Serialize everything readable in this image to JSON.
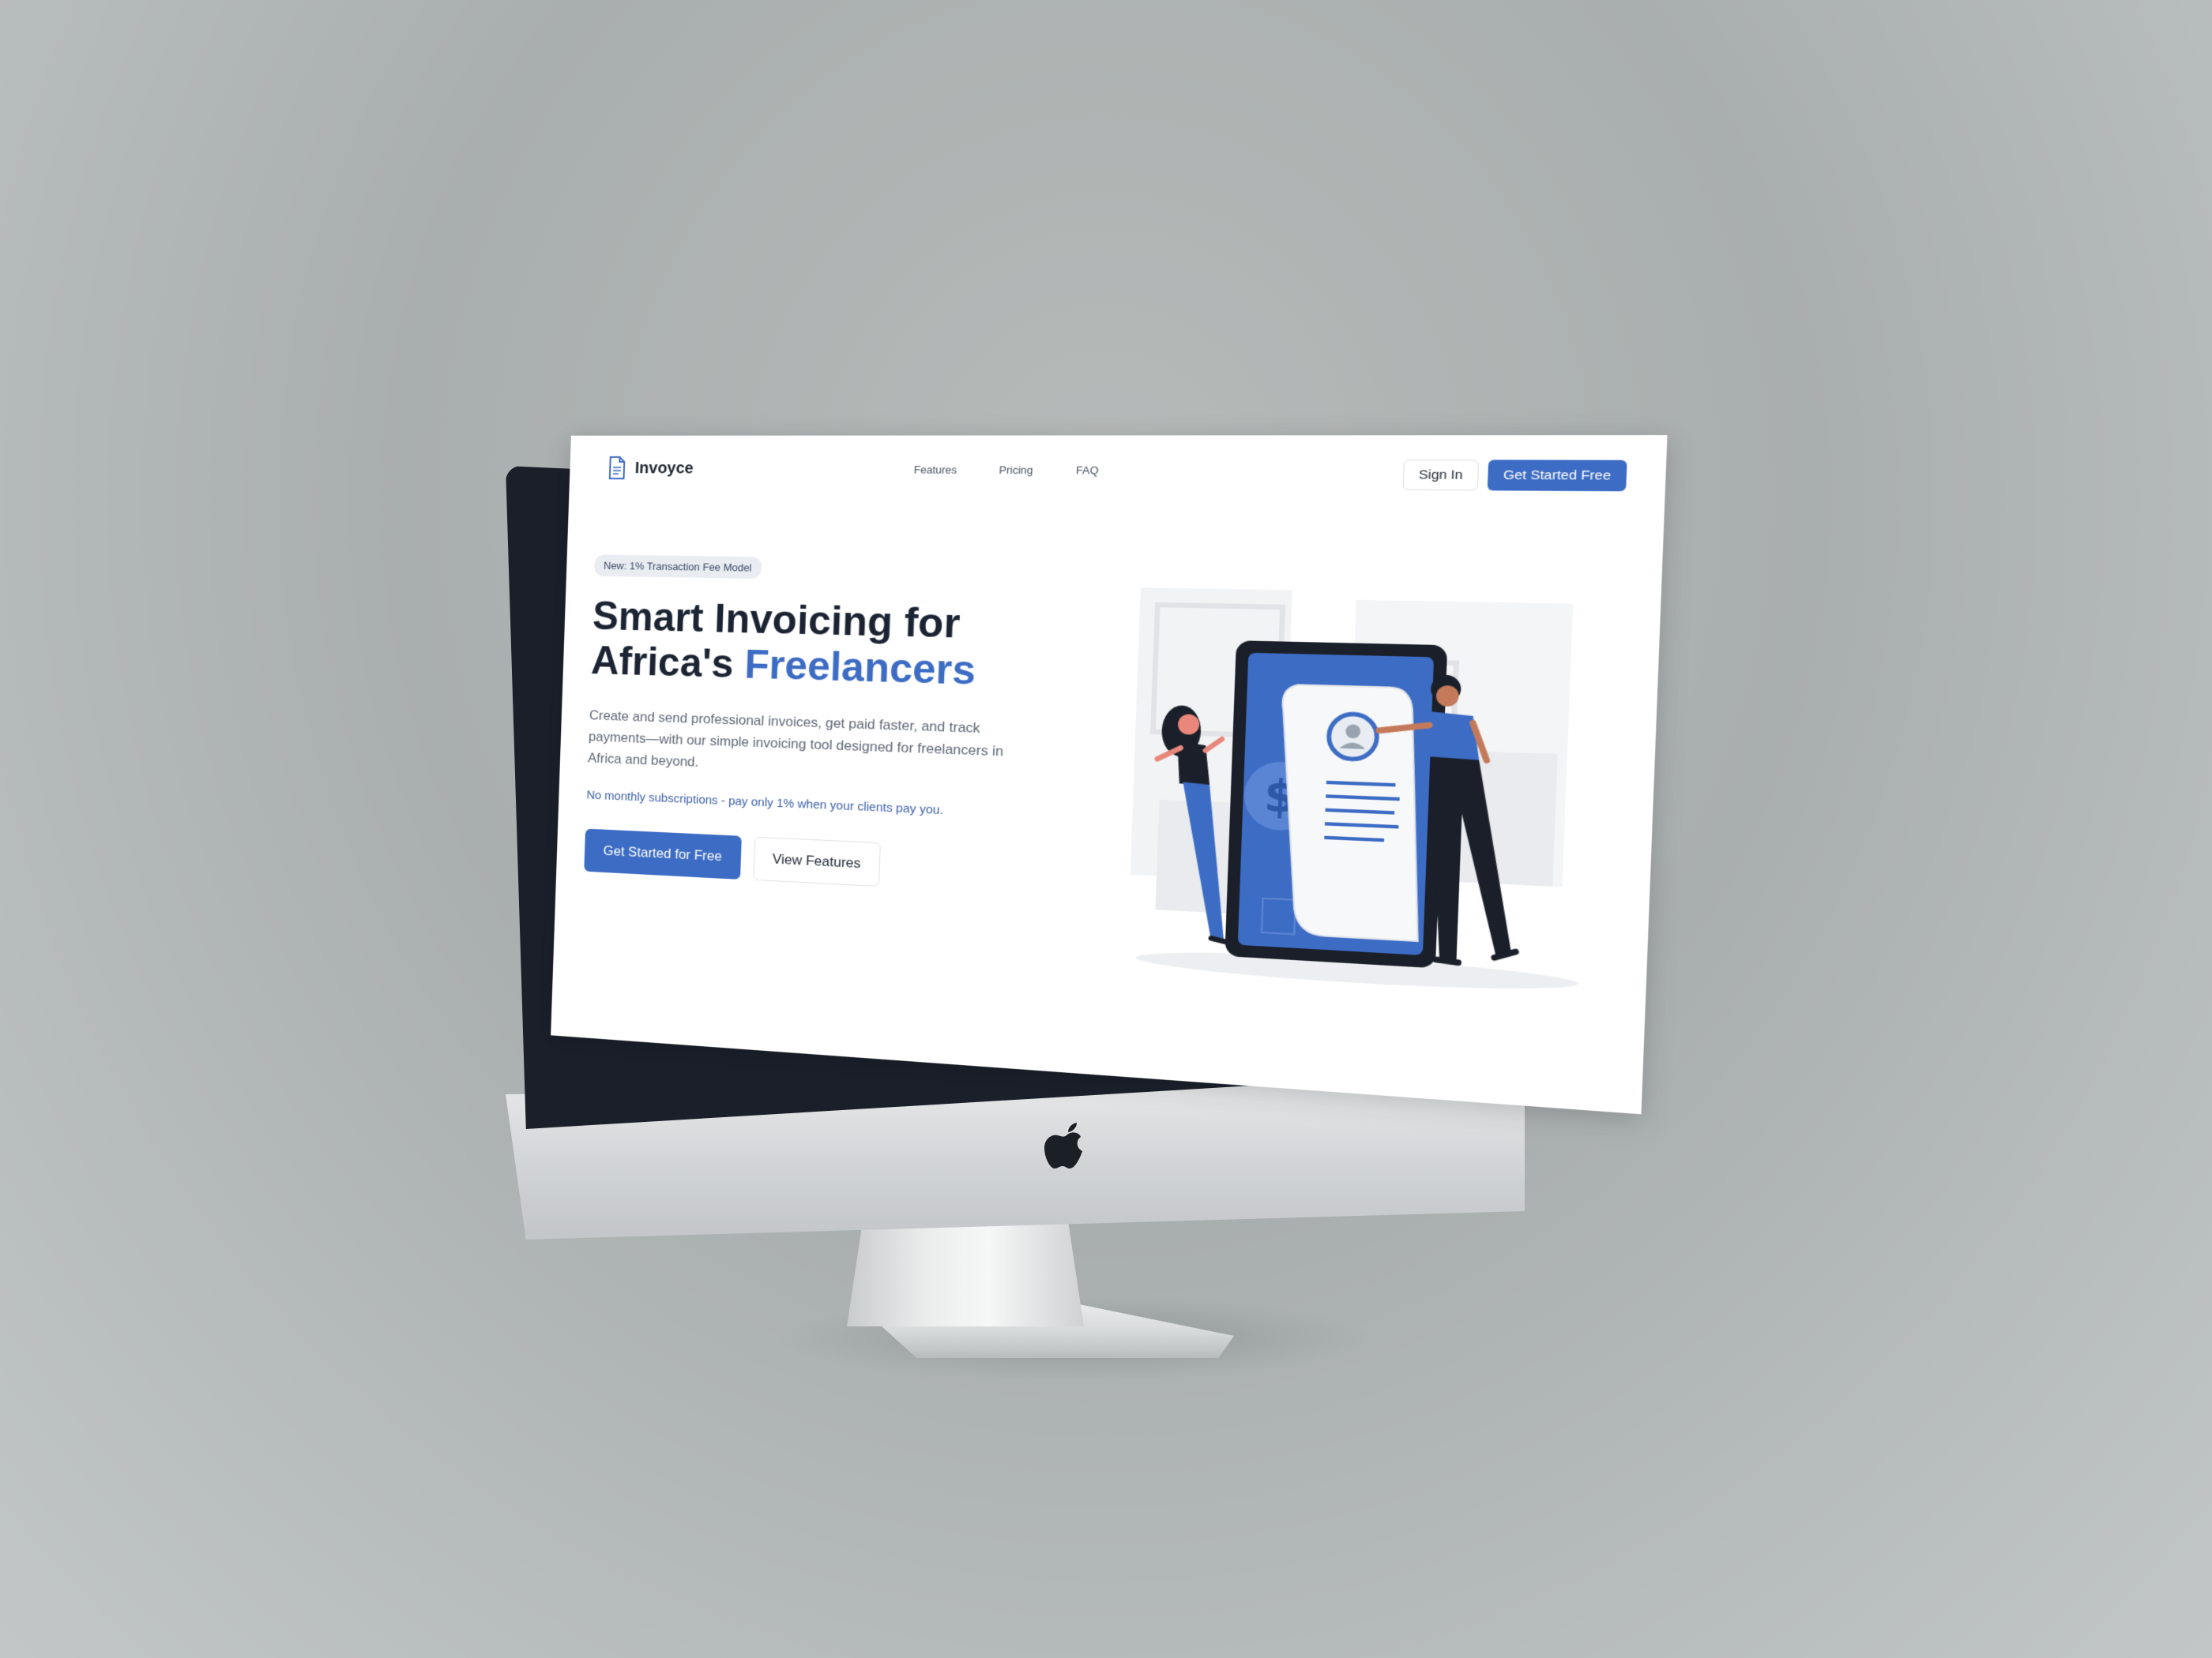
{
  "app": {
    "name": "Invoyce"
  },
  "nav": {
    "links": [
      "Features",
      "Pricing",
      "FAQ"
    ],
    "sign_in": "Sign In",
    "get_started": "Get Started Free"
  },
  "hero": {
    "badge": "New: 1% Transaction Fee Model",
    "headline_part1": "Smart Invoicing for",
    "headline_part2": "Africa's",
    "headline_accent": "Freelancers",
    "subtext": "Create and send professional invoices, get paid faster, and track payments—with our simple invoicing tool designed for freelancers in Africa and beyond.",
    "note": "No monthly subscriptions - pay only 1% when your clients pay you.",
    "cta_primary": "Get Started for Free",
    "cta_secondary": "View Features"
  },
  "colors": {
    "accent": "#3d6cc4",
    "text_dark": "#1c2433",
    "bezel": "#1a1f2a"
  },
  "icons": [
    "document-icon",
    "apple-logo-icon",
    "dollar-icon",
    "user-avatar-icon"
  ]
}
